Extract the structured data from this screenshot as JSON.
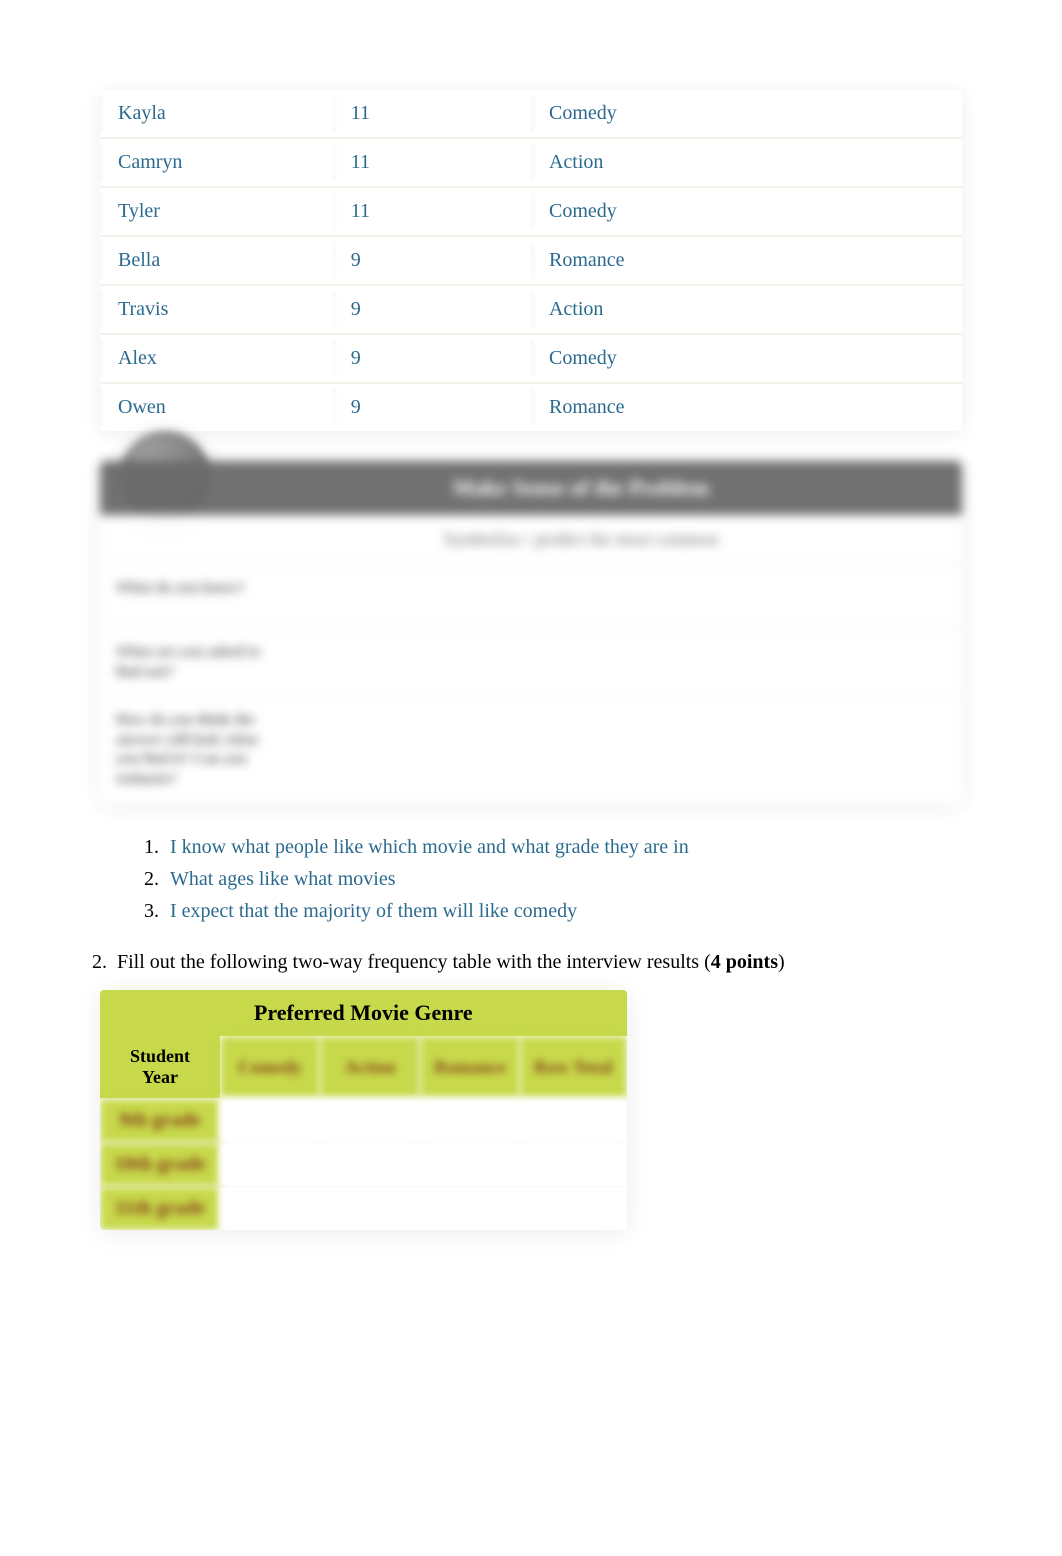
{
  "students": [
    {
      "name": "Kayla",
      "grade": "11",
      "genre": "Comedy"
    },
    {
      "name": "Camryn",
      "grade": "11",
      "genre": "Action"
    },
    {
      "name": "Tyler",
      "grade": "11",
      "genre": "Comedy"
    },
    {
      "name": "Bella",
      "grade": "9",
      "genre": "Romance"
    },
    {
      "name": "Travis",
      "grade": "9",
      "genre": "Action"
    },
    {
      "name": "Alex",
      "grade": "9",
      "genre": "Comedy"
    },
    {
      "name": "Owen",
      "grade": "9",
      "genre": "Romance"
    }
  ],
  "problem_box": {
    "title": "Make Sense of the Problem",
    "subtitle": "Symbolize / predict the most common",
    "rows": [
      {
        "label": "What do you know?"
      },
      {
        "label": "What are you asked to find out?"
      },
      {
        "label": "How do you think the answer will look when you find it? Can you estimate?"
      }
    ]
  },
  "answers": [
    "I know what people like which movie and what grade they are in",
    "What ages like what movies",
    "I expect that the majority of them will like comedy"
  ],
  "q2": {
    "number": "2.",
    "text_prefix": "Fill out the following two-way frequency table with the interview results (",
    "points_label": "4 points",
    "text_suffix": ")"
  },
  "freq_table": {
    "title": "Preferred Movie Genre",
    "row_header": "Student Year",
    "col_headers": [
      "Comedy",
      "Action",
      "Romance",
      "Row Total"
    ],
    "row_labels": [
      "9th grade",
      "10th grade",
      "11th grade"
    ]
  }
}
